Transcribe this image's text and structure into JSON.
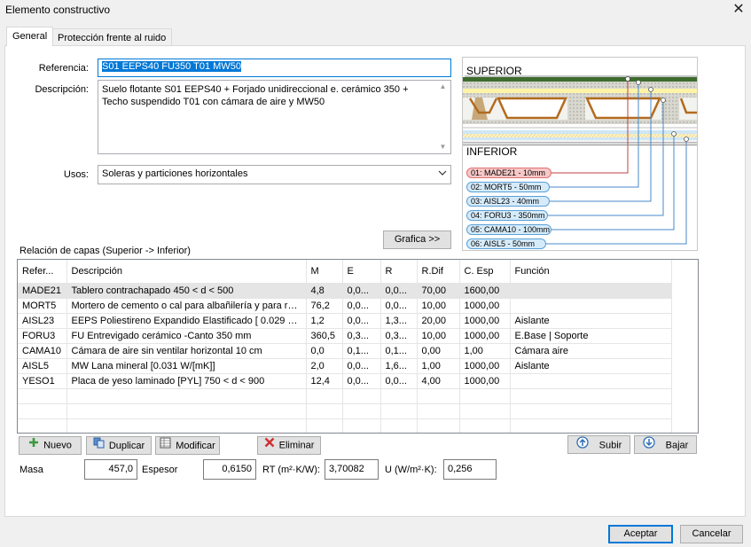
{
  "window": {
    "title": "Elemento constructivo",
    "close_glyph": "✕"
  },
  "tabs": [
    {
      "label": "General"
    },
    {
      "label": "Protección frente al ruido"
    }
  ],
  "form": {
    "referencia_label": "Referencia:",
    "referencia_value": "S01 EEPS40 FU350 T01 MW50",
    "descripcion_label": "Descripción:",
    "descripcion_value": "Suelo flotante S01 EEPS40 + Forjado unidireccional e. cerámico 350 + Techo suspendido T01 con cámara de aire y  MW50",
    "usos_label": "Usos:",
    "usos_value": "Soleras y particiones horizontales",
    "grafica_button": "Grafica >>",
    "relacion_label": "Relación de capas  (Superior -> Inferior)"
  },
  "diagram": {
    "superior_label": "SUPERIOR",
    "inferior_label": "INFERIOR",
    "layers": [
      {
        "label": "01: MADE21 - 10mm",
        "highlight": true
      },
      {
        "label": "02: MORT5 - 50mm",
        "highlight": false
      },
      {
        "label": "03: AISL23 - 40mm",
        "highlight": false
      },
      {
        "label": "04: FORU3 - 350mm",
        "highlight": false
      },
      {
        "label": "05: CAMA10 - 100mm",
        "highlight": false
      },
      {
        "label": "06: AISL5 - 50mm",
        "highlight": false
      }
    ]
  },
  "table": {
    "columns": [
      "Refer...",
      "Descripción",
      "M",
      "E",
      "R",
      "R.Dif",
      "C. Esp",
      "Función"
    ],
    "rows": [
      [
        "MADE21",
        "Tablero contrachapado 450 < d < 500",
        "4,8",
        "0,0...",
        "0,0...",
        "70,00",
        "1600,00",
        ""
      ],
      [
        "MORT5",
        "Mortero de cemento o cal para albañilería y para re...",
        "76,2",
        "0,0...",
        "0,0...",
        "10,00",
        "1000,00",
        ""
      ],
      [
        "AISL23",
        "EEPS Poliestireno Expandido Elastificado [ 0.029 W...",
        "1,2",
        "0,0...",
        "1,3...",
        "20,00",
        "1000,00",
        "Aislante"
      ],
      [
        "FORU3",
        "FU Entrevigado cerámico -Canto 350 mm",
        "360,5",
        "0,3...",
        "0,3...",
        "10,00",
        "1000,00",
        "E.Base | Soporte"
      ],
      [
        "CAMA10",
        "Cámara de aire sin ventilar horizontal 10 cm",
        "0,0",
        "0,1...",
        "0,1...",
        "0,00",
        "1,00",
        "Cámara aire"
      ],
      [
        "AISL5",
        "MW Lana mineral [0.031 W/[mK]]",
        "2,0",
        "0,0...",
        "1,6...",
        "1,00",
        "1000,00",
        "Aislante"
      ],
      [
        "YESO1",
        "Placa de yeso laminado [PYL] 750 < d < 900",
        "12,4",
        "0,0...",
        "0,0...",
        "4,00",
        "1000,00",
        ""
      ]
    ],
    "selected_row": 0
  },
  "actions": {
    "nuevo": "Nuevo",
    "duplicar": "Duplicar",
    "modificar": "Modificar",
    "eliminar": "Eliminar",
    "subir": "Subir",
    "bajar": "Bajar"
  },
  "summary": {
    "masa_label": "Masa",
    "masa_value": "457,0",
    "espesor_label": "Espesor",
    "espesor_value": "0,6150",
    "rt_label": "RT (m²·K/W):",
    "rt_value": "3,70082",
    "u_label": "U (W/m²·K):",
    "u_value": "0,256"
  },
  "dialog": {
    "aceptar": "Aceptar",
    "cancelar": "Cancelar"
  },
  "colors": {
    "accent": "#0078d7",
    "highlight_fill": "#f8c8c8",
    "highlight_border": "#e07070",
    "layer_fill": "#d6ebfa",
    "layer_border": "#5aa0d8",
    "add_icon": "#3a9a3a",
    "delete_icon": "#d03030"
  }
}
